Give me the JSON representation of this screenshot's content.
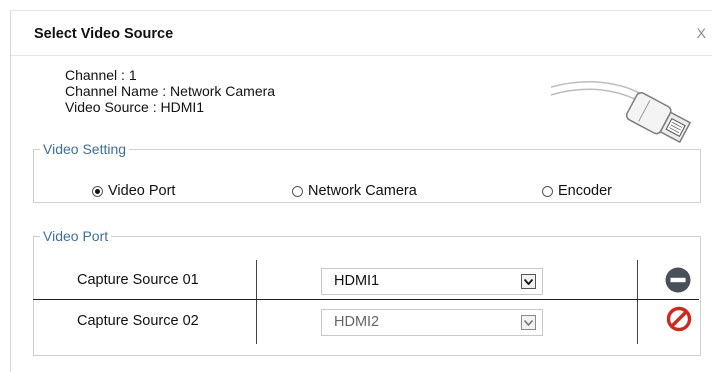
{
  "dialog": {
    "title": "Select Video Source",
    "close_label": "X"
  },
  "info": {
    "channel": "Channel : 1",
    "channel_name": "Channel Name : Network Camera",
    "video_source": "Video Source : HDMI1"
  },
  "video_setting": {
    "legend": "Video Setting",
    "options": [
      {
        "label": "Video Port",
        "selected": true
      },
      {
        "label": "Network Camera",
        "selected": false
      },
      {
        "label": "Encoder",
        "selected": false
      }
    ]
  },
  "video_port": {
    "legend": "Video Port",
    "rows": [
      {
        "label": "Capture Source 01",
        "value": "HDMI1",
        "enabled": true,
        "action_icon": "remove-icon"
      },
      {
        "label": "Capture Source 02",
        "value": "HDMI2",
        "enabled": false,
        "action_icon": "prohibited-icon"
      }
    ]
  },
  "colors": {
    "legend": "#3f6f98",
    "remove_button": "#4a4f5a",
    "prohibited": "#cc2a1e"
  },
  "icons": {
    "plug": "hdmi-plug-icon",
    "dropdown": "chevron-down-icon"
  }
}
